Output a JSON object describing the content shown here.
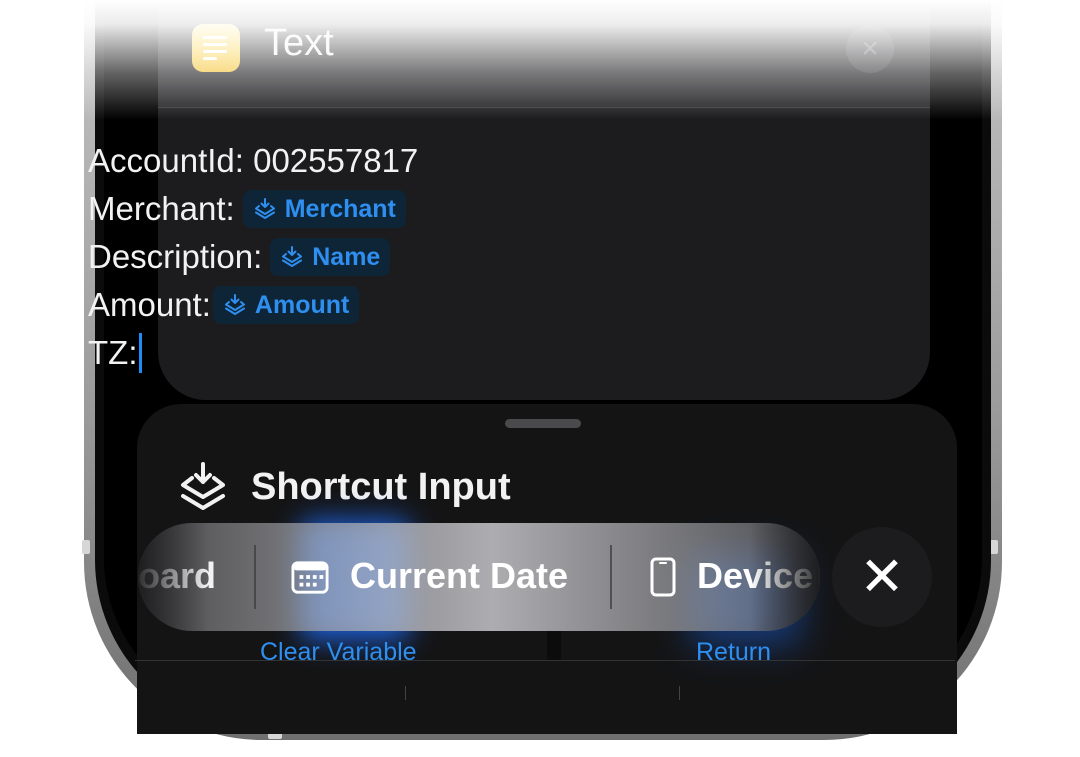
{
  "text_action": {
    "title": "Text",
    "account_prefix": "AccountId: 002557817",
    "merchant_label": "Merchant:",
    "merchant_token": "Merchant",
    "description_label": "Description:",
    "description_token": "Name",
    "amount_label": "Amount:",
    "amount_token": "Amount",
    "tz_label": "TZ:"
  },
  "sheet": {
    "title": "Shortcut Input",
    "bottom_left": "Clear Variable",
    "bottom_right": "Return"
  },
  "suggestions": {
    "items": [
      "oard",
      "Current Date",
      "Device"
    ]
  },
  "colors": {
    "token_blue": "#2e8ff0",
    "caret_blue": "#1d8cf8",
    "app_icon_yellow": "#f5c53a",
    "card_bg": "#1c1c1e"
  },
  "icons": {
    "app": "text-lines-icon",
    "variable": "layers-download-icon",
    "calendar": "calendar-icon",
    "phone": "phone-icon",
    "dismiss": "close-icon"
  }
}
